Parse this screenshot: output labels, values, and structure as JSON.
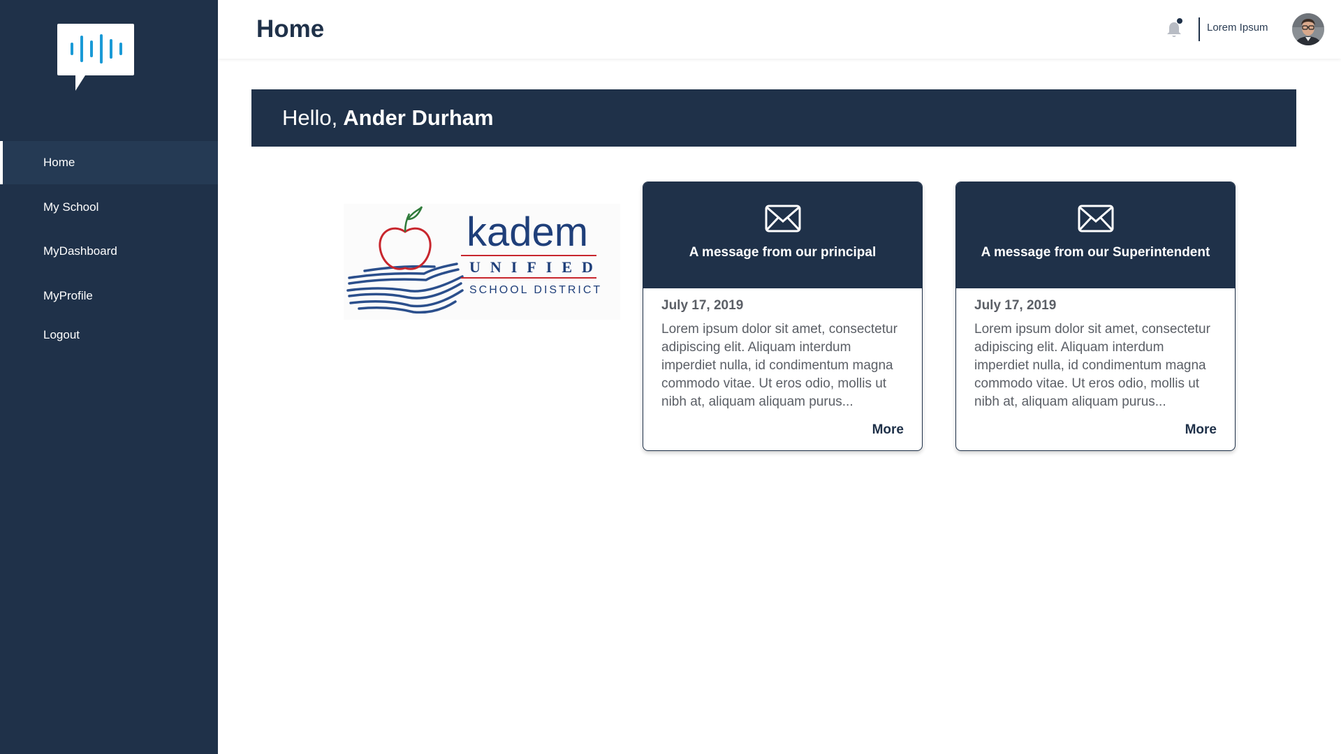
{
  "header": {
    "title": "Home",
    "user_name": "Lorem Ipsum",
    "bell_icon": "bell-icon",
    "avatar": "user-avatar"
  },
  "sidebar": {
    "logo": "chat-audio-logo",
    "items": [
      {
        "label": "Home",
        "active": true
      },
      {
        "label": "My School",
        "active": false
      },
      {
        "label": "MyDashboard",
        "active": false
      },
      {
        "label": "MyProfile",
        "active": false
      },
      {
        "label": "Logout",
        "active": false
      }
    ]
  },
  "banner": {
    "greeting": "Hello,",
    "name": "Ander Durham"
  },
  "school_logo": {
    "name": "kadem",
    "line2": "UNIFIED",
    "line3": "SCHOOL DISTRICT"
  },
  "cards": [
    {
      "icon": "envelope-icon",
      "title": "A message from our principal",
      "date": "July 17, 2019",
      "text": "Lorem ipsum dolor sit amet, consectetur adipiscing elit. Aliquam interdum imperdiet nulla, id condimentum magna commodo vitae. Ut eros odio, mollis ut nibh at, aliquam aliquam purus...",
      "more": "More"
    },
    {
      "icon": "envelope-icon",
      "title": "A message from our Superintendent",
      "date": "July 17, 2019",
      "text": "Lorem ipsum dolor sit amet, consectetur adipiscing elit. Aliquam interdum imperdiet nulla, id condimentum magna commodo vitae. Ut eros odio, mollis ut nibh at, aliquam aliquam purus...",
      "more": "More"
    }
  ],
  "colors": {
    "navy": "#1f3149",
    "accent_blue": "#1a9ad6",
    "text_gray": "#5b5f66",
    "apple_red": "#c8262d"
  }
}
